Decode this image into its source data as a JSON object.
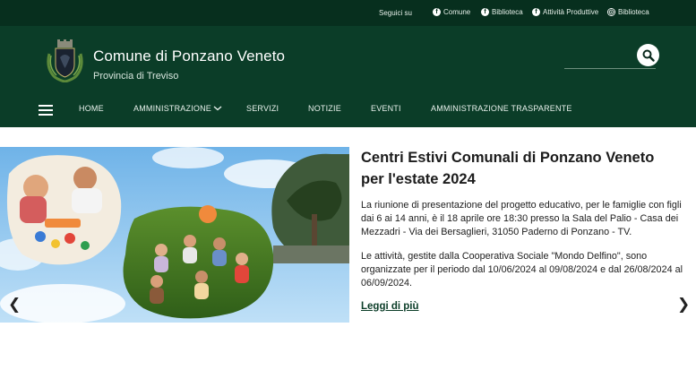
{
  "topbar": {
    "follow_label": "Seguici su",
    "social": [
      {
        "label": "Comune",
        "icon": "facebook-icon"
      },
      {
        "label": "Biblioteca",
        "icon": "facebook-icon"
      },
      {
        "label": "Attività Produttive",
        "icon": "facebook-icon"
      },
      {
        "label": "Biblioteca",
        "icon": "instagram-icon"
      }
    ]
  },
  "header": {
    "title": "Comune di Ponzano Veneto",
    "subtitle": "Provincia di Treviso",
    "search_icon": "search-icon",
    "menu_icon": "hamburger-menu-icon"
  },
  "nav": {
    "items": [
      "HOME",
      "AMMINISTRAZIONE",
      "SERVIZI",
      "NOTIZIE",
      "EVENTI",
      "AMMINISTRAZIONE TRASPARENTE"
    ]
  },
  "slide": {
    "title_line1": "Centri Estivi Comunali di Ponzano Veneto",
    "title_line2": "per l'estate 2024",
    "paragraph1": "La riunione di presentazione del progetto educativo, per le famiglie con figli dai 6 ai 14 anni, è il 18 aprile ore 18:30 presso la Sala del Palio - Casa dei Mezzadri - Via dei Bersaglieri, 31050 Paderno di Ponzano - TV.",
    "paragraph2": "Le attività, gestite dalla Cooperativa Sociale \"Mondo Delfino\", sono organizzate per il periodo dal 10/06/2024 al 09/08/2024 e dal 26/08/2024 al 06/09/2024.",
    "read_more": "Leggi di più",
    "prev": "❮",
    "next": "❯"
  },
  "colors": {
    "topbar_bg": "#072f1e",
    "header_bg": "#0b3d28",
    "text_dark": "#1c1c1c"
  }
}
